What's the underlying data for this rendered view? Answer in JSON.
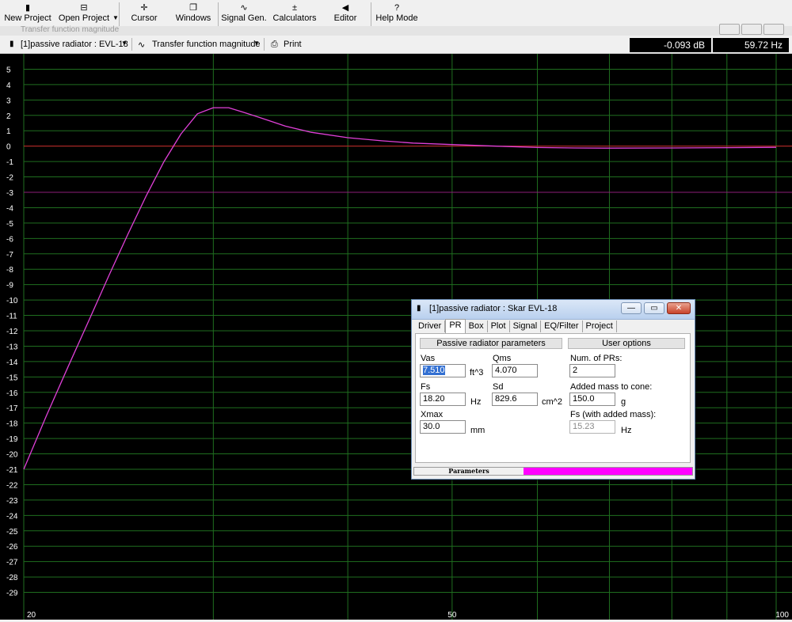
{
  "toolbar": [
    {
      "name": "new-project-button",
      "icon_name": "document-icon",
      "icon": "▮",
      "label": "New Project"
    },
    {
      "name": "open-project-button",
      "icon_name": "folder-open-icon",
      "icon": "⊟",
      "label": "Open Project"
    },
    {
      "name": "cursor-button",
      "icon_name": "crosshair-icon",
      "icon": "✛",
      "label": "Cursor"
    },
    {
      "name": "windows-button",
      "icon_name": "windows-icon",
      "icon": "❐",
      "label": "Windows"
    },
    {
      "name": "signal-gen-button",
      "icon_name": "sine-wave-icon",
      "icon": "∿",
      "label": "Signal Gen."
    },
    {
      "name": "calculators-button",
      "icon_name": "calculator-icon",
      "icon": "±",
      "label": "Calculators"
    },
    {
      "name": "editor-button",
      "icon_name": "speaker-icon",
      "icon": "◀",
      "label": "Editor"
    },
    {
      "name": "help-mode-button",
      "icon_name": "question-icon",
      "icon": "?",
      "label": "Help Mode"
    }
  ],
  "window_title": "Transfer function magnitude",
  "subbar": {
    "project_select": "[1]passive radiator : EVL-18",
    "plot_select": "Transfer function magnitude",
    "print_label": "Print",
    "cursor_db": "-0.093 dB",
    "cursor_hz": "59.72 Hz"
  },
  "chart_data": {
    "type": "line",
    "title": "",
    "xlabel": "",
    "ylabel": "",
    "xscale": "log",
    "xlim": [
      20,
      100
    ],
    "ylim": [
      -30,
      6
    ],
    "x_ticks": [
      "20",
      "50",
      "100"
    ],
    "y_ticks": [
      "5",
      "4",
      "3",
      "2",
      "1",
      "0",
      "-1",
      "-2",
      "-3",
      "-4",
      "-5",
      "-6",
      "-7",
      "-8",
      "-9",
      "-10",
      "-11",
      "-12",
      "-13",
      "-14",
      "-15",
      "-16",
      "-17",
      "-18",
      "-19",
      "-20",
      "-21",
      "-22",
      "-23",
      "-24",
      "-25",
      "-26",
      "-27",
      "-28",
      "-29"
    ],
    "grid": true,
    "reference_lines": [
      {
        "y": 0,
        "color": "#c81e28"
      },
      {
        "y": -3,
        "color": "#8c1e78"
      }
    ],
    "series": [
      {
        "color": "#e040d8",
        "x": [
          20,
          21,
          22,
          23,
          24,
          25,
          26,
          27,
          28,
          29,
          30,
          31,
          32,
          33,
          34,
          35,
          37,
          40,
          43,
          46,
          50,
          55,
          60,
          65,
          70,
          80,
          90,
          100
        ],
        "y": [
          -21.0,
          -17.5,
          -14.3,
          -11.3,
          -8.4,
          -5.7,
          -3.2,
          -1.0,
          0.8,
          2.1,
          2.5,
          2.5,
          2.2,
          1.9,
          1.6,
          1.3,
          0.9,
          0.55,
          0.35,
          0.2,
          0.1,
          0.0,
          -0.09,
          -0.12,
          -0.13,
          -0.12,
          -0.1,
          -0.08
        ]
      }
    ]
  },
  "dialog": {
    "title": "[1]passive radiator : Skar EVL-18",
    "controls": {
      "minimize": "—",
      "maximize": "▭",
      "close": "✕"
    },
    "tabs": [
      "Driver",
      "PR",
      "Box",
      "Plot",
      "Signal",
      "EQ/Filter",
      "Project"
    ],
    "active_tab": "PR",
    "pr_header": "Passive radiator parameters",
    "user_header": "User options",
    "vas_label": "Vas",
    "vas_value": "7.510",
    "vas_unit": "ft^3",
    "qms_label": "Qms",
    "qms_value": "4.070",
    "fs_label": "Fs",
    "fs_value": "18.20",
    "fs_unit": "Hz",
    "sd_label": "Sd",
    "sd_value": "829.6",
    "sd_unit": "cm^2",
    "xmax_label": "Xmax",
    "xmax_value": "30.0",
    "xmax_unit": "mm",
    "num_prs_label": "Num. of PRs:",
    "num_prs_value": "2",
    "added_mass_label": "Added mass to cone:",
    "added_mass_value": "150.0",
    "added_mass_unit": "g",
    "fs_added_label": "Fs (with added mass):",
    "fs_added_value": "15.23",
    "fs_added_unit": "Hz",
    "status_label": "Parameters",
    "status_color": "#ff00ff"
  }
}
